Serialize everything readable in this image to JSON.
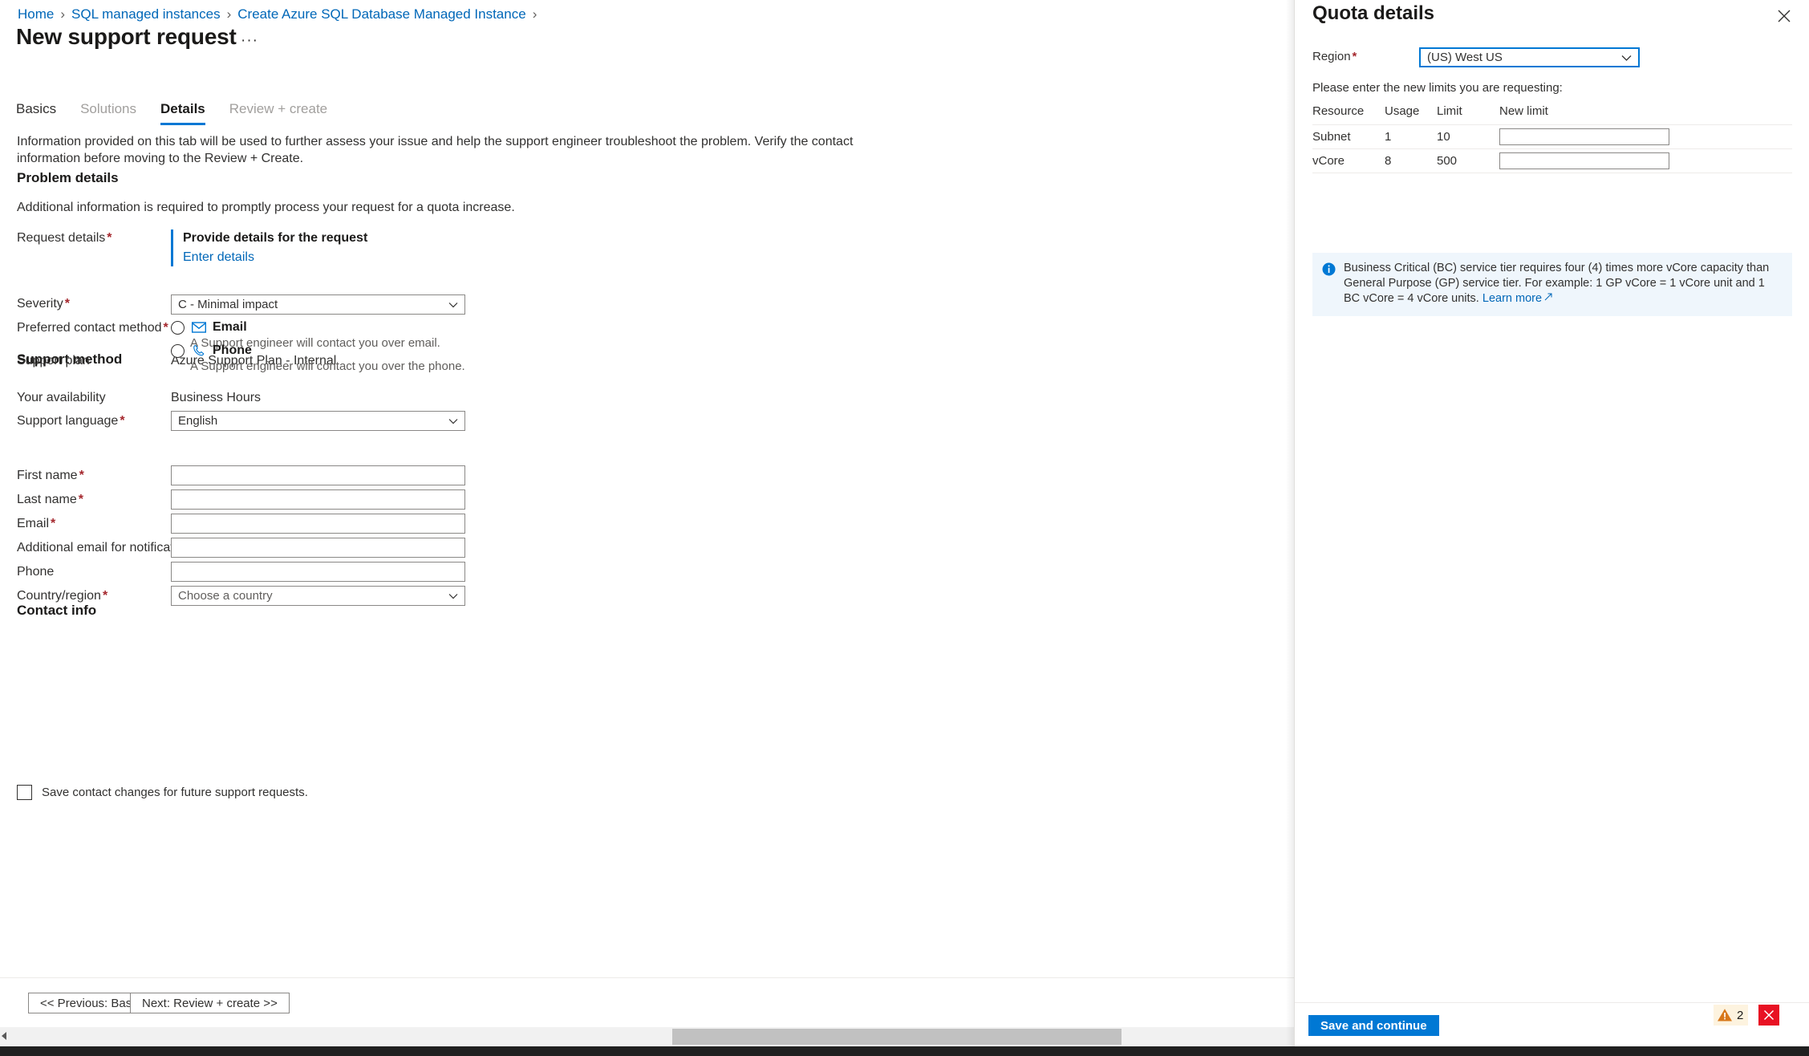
{
  "breadcrumb": {
    "items": [
      {
        "label": "Home",
        "type": "link"
      },
      {
        "label": "SQL managed instances",
        "type": "link"
      },
      {
        "label": "Create Azure SQL Database Managed Instance",
        "type": "link"
      }
    ],
    "separator": "›"
  },
  "header": {
    "title": "New support request",
    "ellipsis": "···"
  },
  "tabs": [
    {
      "label": "Basics",
      "state": "enabled"
    },
    {
      "label": "Solutions",
      "state": "disabled"
    },
    {
      "label": "Details",
      "state": "active"
    },
    {
      "label": "Review + create",
      "state": "disabled"
    }
  ],
  "main": {
    "intro": "Information provided on this tab will be used to further assess your issue and help the support engineer troubleshoot the problem. Verify the contact information before moving to the Review + Create.",
    "problem_details": {
      "heading": "Problem details",
      "note": "Additional information is required to promptly process your request for a quota increase.",
      "request_details_label": "Request details",
      "request_details_required": "*",
      "provide_details_title": "Provide details for the request",
      "enter_details_link": "Enter details"
    },
    "support_method": {
      "heading": "Support method",
      "support_plan_label": "Support plan",
      "support_plan_value": "Azure Support Plan - Internal",
      "severity_label": "Severity",
      "severity_required": "*",
      "severity_value": "C - Minimal impact",
      "contact_method_label": "Preferred contact method",
      "contact_method_required": "*",
      "options": [
        {
          "label": "Email",
          "description": "A Support engineer will contact you over email.",
          "icon": "envelope-icon",
          "selected": false
        },
        {
          "label": "Phone",
          "description": "A Support engineer will contact you over the phone.",
          "icon": "phone-icon",
          "selected": false
        }
      ],
      "availability_label": "Your availability",
      "availability_value": "Business Hours",
      "language_label": "Support language",
      "language_required": "*",
      "language_value": "English"
    },
    "contact_info": {
      "heading": "Contact info",
      "fields": [
        {
          "label": "First name",
          "required": "*",
          "value": "",
          "placeholder": ""
        },
        {
          "label": "Last name",
          "required": "*",
          "value": "",
          "placeholder": ""
        },
        {
          "label": "Email",
          "required": "*",
          "value": "",
          "placeholder": ""
        },
        {
          "label": "Additional email for notification",
          "required": "",
          "value": "",
          "placeholder": ""
        },
        {
          "label": "Phone",
          "required": "",
          "value": "",
          "placeholder": ""
        }
      ],
      "country_label": "Country/region",
      "country_required": "*",
      "country_placeholder": "Choose a country",
      "save_contact_label": "Save contact changes for future support requests.",
      "save_contact_checked": false
    },
    "footer": {
      "previous_label": "<< Previous: Basics",
      "next_label": "Next: Review + create >>"
    }
  },
  "context_pane": {
    "title": "Quota details",
    "close_icon": "close-icon",
    "region_label": "Region",
    "region_required": "*",
    "region_value": "(US) West US",
    "instruction": "Please enter the new limits you are requesting:",
    "table": {
      "columns": [
        "Resource",
        "Usage",
        "Limit",
        "New limit"
      ],
      "rows": [
        {
          "resource": "Subnet",
          "usage": "1",
          "limit": "10",
          "new_limit": "",
          "placeholder": ""
        },
        {
          "resource": "vCore",
          "usage": "8",
          "limit": "500",
          "new_limit": "",
          "placeholder": ""
        }
      ]
    },
    "info_banner": {
      "icon": "info-icon",
      "text": "Business Critical (BC) service tier requires four (4) times more vCore capacity than General Purpose (GP) service tier. For example: 1 GP vCore = 1 vCore unit and 1 BC vCore = 4 vCore units. ",
      "link_label": "Learn more"
    },
    "footer": {
      "save_label": "Save and continue",
      "warning_count": "2",
      "warning_icon": "warning-triangle-icon",
      "close_error_icon": "close-icon"
    }
  },
  "colors": {
    "accent": "#0078d4",
    "link": "#0067b8",
    "required": "#a4262c",
    "error": "#e81123",
    "warning_bg": "#fdf3df",
    "info_bg": "#eff6fc"
  }
}
